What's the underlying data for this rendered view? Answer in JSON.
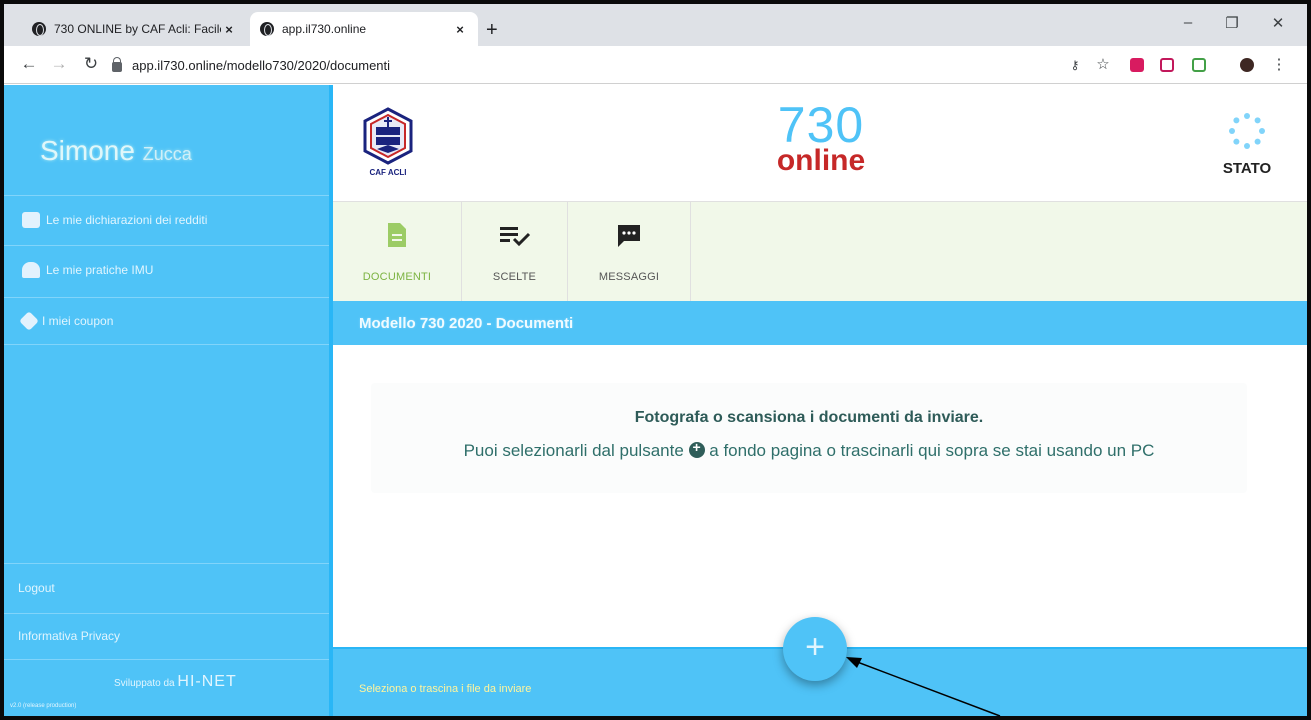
{
  "browser": {
    "tabs": [
      {
        "title": "730 ONLINE by CAF Acli: Facile,",
        "close": "×"
      },
      {
        "title": "app.il730.online",
        "close": "×"
      }
    ],
    "new_tab": "+",
    "url": "app.il730.online/modello730/2020/documenti"
  },
  "sidebar": {
    "first_name": "Simone",
    "last_name": "Zucca",
    "items": [
      {
        "label": "Le mie dichiarazioni dei redditi"
      },
      {
        "label": "Le mie pratiche IMU"
      },
      {
        "label": "I miei coupon"
      }
    ],
    "logout": "Logout",
    "privacy": "Informativa Privacy",
    "developed_by": "Sviluppato da",
    "developer": "HI-NET",
    "version": "v2.0 (release production)"
  },
  "header": {
    "logo_text": "CAF ACLI",
    "brand_number": "730",
    "brand_word": "online",
    "status_label": "STATO"
  },
  "tabs": [
    {
      "label": "DOCUMENTI"
    },
    {
      "label": "SCELTE"
    },
    {
      "label": "MESSAGGI"
    }
  ],
  "breadcrumb": "Modello 730 2020 - Documenti",
  "dropzone": {
    "title": "Fotografa o scansiona i documenti da inviare.",
    "line_before": "Puoi selezionarli dal pulsante",
    "line_after": "a fondo pagina o trascinarli qui sopra se stai usando un PC"
  },
  "footer": {
    "hint": "Seleziona o trascina i file da inviare",
    "fab_label": "+"
  }
}
